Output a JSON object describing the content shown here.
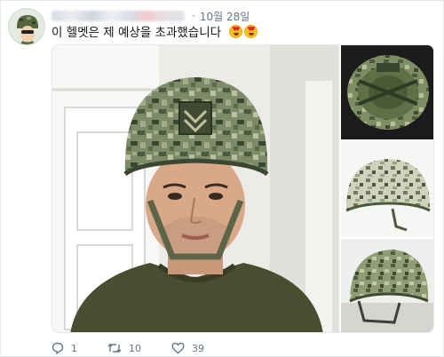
{
  "tweet": {
    "date": "10월 28일",
    "dot": "·",
    "text": "이 헬멧은 제 예상을 초과했습니다",
    "emoji": [
      "heart-eyes-emoji",
      "heart-eyes-emoji"
    ]
  },
  "actions": {
    "reply_count": "1",
    "retweet_count": "10",
    "like_count": "39"
  },
  "colors": {
    "secondary_text": "#657786",
    "border": "#e1e8ed",
    "camo_dark": "#4b5a3e",
    "camo_mid": "#7d8a68",
    "camo_light": "#b9bfa3"
  }
}
